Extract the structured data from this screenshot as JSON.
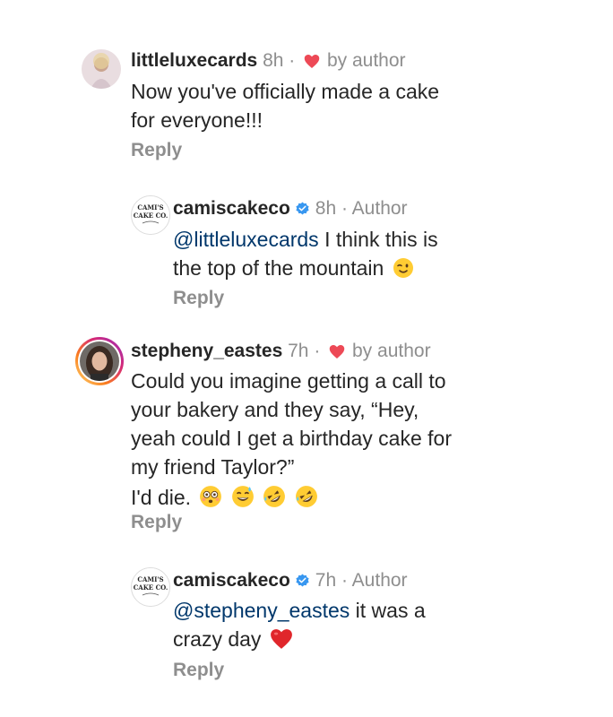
{
  "comments": [
    {
      "username": "littleluxecards",
      "time": "8h",
      "separator": "·",
      "author_note": "by author",
      "text": "Now you've officially made a cake",
      "text_line2": "for everyone!!!",
      "reply_label": "Reply",
      "avatar_icon": "profile-photo-icon"
    },
    {
      "username": "camiscakeco",
      "time": "8h",
      "separator": "·",
      "author_note": "Author",
      "mention": "@littleluxecards",
      "text": "I think this is",
      "text_line2": "the top of the mountain",
      "emojis": [
        "winking-face-emoji"
      ],
      "reply_label": "Reply",
      "avatar_text": [
        "CAMI'S",
        "CAKE CO."
      ],
      "verified_icon": "verified-badge-icon"
    },
    {
      "username": "stepheny_eastes",
      "time": "7h",
      "separator": "·",
      "author_note": "by author",
      "text_lines": [
        "Could you imagine getting a call to",
        "your bakery and they say, “Hey,",
        "yeah could I get a birthday cake for",
        "my friend Taylor?”"
      ],
      "text_last": "I'd die.",
      "emojis": [
        "flushed-face-emoji",
        "grinning-sweat-emoji",
        "rofl-emoji",
        "rofl-emoji"
      ],
      "reply_label": "Reply",
      "avatar_icon": "story-ring-profile-photo-icon"
    },
    {
      "username": "camiscakeco",
      "time": "7h",
      "separator": "·",
      "author_note": "Author",
      "mention": "@stepheny_eastes",
      "text": "it was a",
      "text_line2": "crazy day",
      "emojis": [
        "red-heart-emoji"
      ],
      "reply_label": "Reply",
      "avatar_text": [
        "CAMI'S",
        "CAKE CO."
      ],
      "verified_icon": "verified-badge-icon"
    }
  ],
  "colors": {
    "text": "#262626",
    "muted": "#8e8e8e",
    "mention": "#00376b",
    "heart": "#ed4956",
    "verified": "#3897f0"
  }
}
